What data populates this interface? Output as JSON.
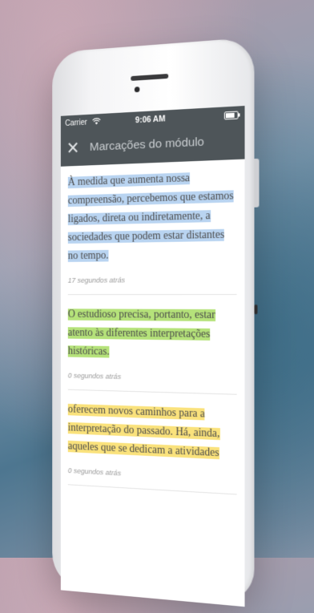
{
  "status_bar": {
    "carrier": "Carrier",
    "wifi_icon": "wifi-icon",
    "time": "9:06 AM",
    "battery_icon": "battery-icon"
  },
  "nav": {
    "close_icon": "close-icon",
    "close_glyph": "✕",
    "title": "Marcações do módulo"
  },
  "highlights": [
    {
      "color": "#b9d4f1",
      "text": "À medida que aumenta nossa compreensão, percebemos que estamos ligados, direta ou indiretamente, a sociedades que podem estar distantes no tempo.",
      "time": "17 segundos atrás"
    },
    {
      "color": "#b5e27a",
      "text": "O estudioso precisa, portanto, estar atento às diferentes interpretações históricas.",
      "time": "0 segundos atrás"
    },
    {
      "color": "#fae27c",
      "text": "oferecem novos caminhos para a interpretação do passado. Há, ainda, aqueles que se dedicam a atividades",
      "time": "0 segundos atrás"
    }
  ]
}
